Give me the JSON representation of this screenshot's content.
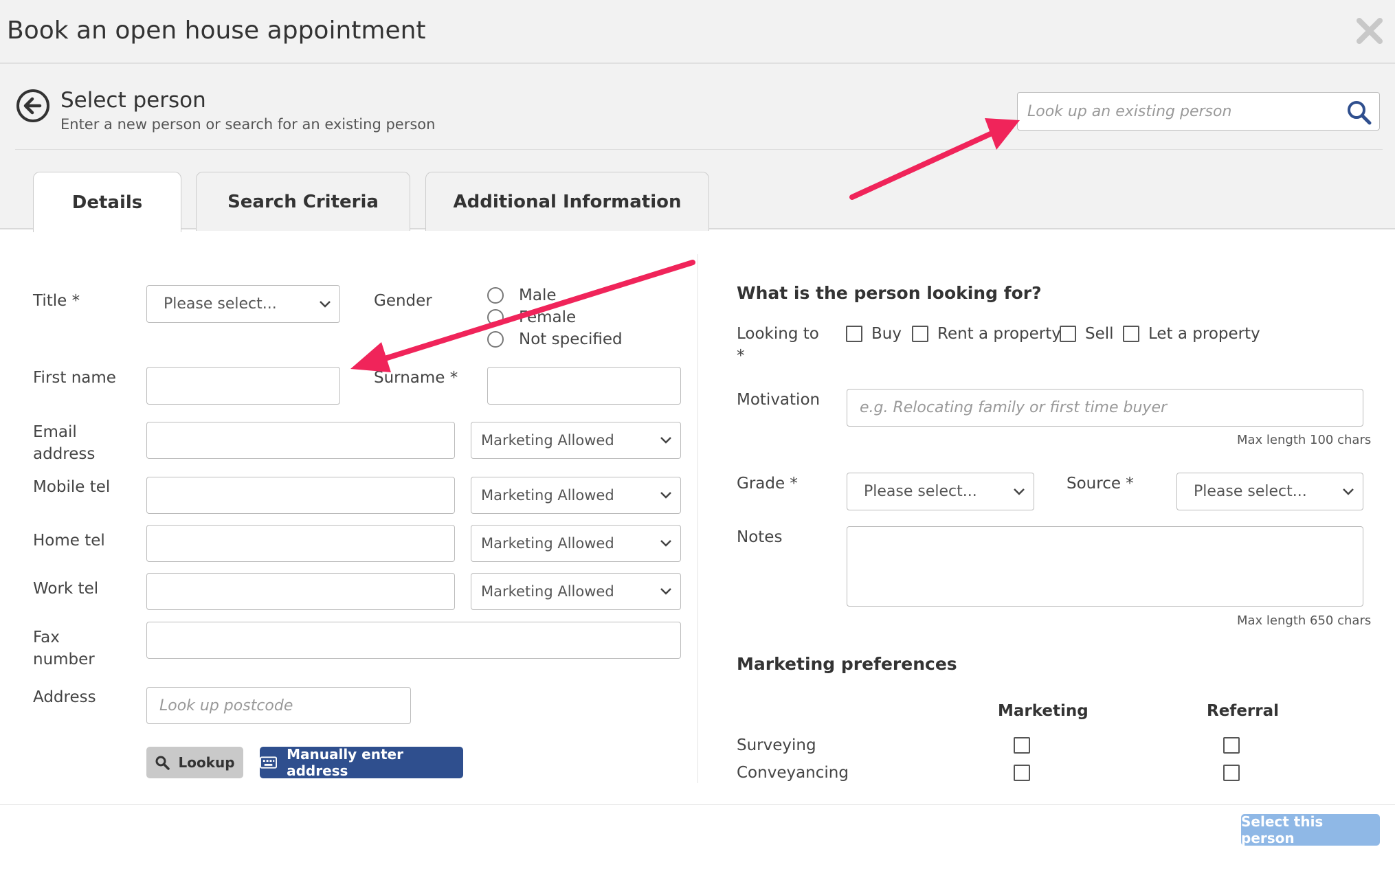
{
  "modal": {
    "title": "Book an open house appointment",
    "close_icon": "close-icon"
  },
  "person_bar": {
    "title": "Select person",
    "subtitle": "Enter a new person or search for an existing person",
    "lookup_placeholder": "Look up an existing person"
  },
  "tabs": [
    {
      "label": "Details",
      "active": true
    },
    {
      "label": "Search Criteria",
      "active": false
    },
    {
      "label": "Additional Information",
      "active": false
    }
  ],
  "details": {
    "title_label": "Title *",
    "title_select": "Please select...",
    "gender_label": "Gender",
    "gender_options": [
      "Male",
      "Female",
      "Not specified"
    ],
    "first_name_label": "First name",
    "surname_label": "Surname *",
    "email_label_1": "Email",
    "email_label_2": "address",
    "mobile_label": "Mobile tel",
    "home_label": "Home tel",
    "work_label": "Work tel",
    "fax_label_1": "Fax",
    "fax_label_2": "number",
    "address_label": "Address",
    "marketing_select": "Marketing Allowed",
    "postcode_placeholder": "Look up postcode",
    "lookup_button": "Lookup",
    "manual_button": "Manually enter address"
  },
  "looking": {
    "heading": "What is the person looking for?",
    "looking_to_label_1": "Looking to",
    "looking_to_label_2": "*",
    "options": [
      "Buy",
      "Rent a property",
      "Sell",
      "Let a property"
    ],
    "motivation_label": "Motivation",
    "motivation_placeholder": "e.g. Relocating family or first time buyer",
    "motivation_hint": "Max length 100 chars",
    "grade_label": "Grade *",
    "grade_select": "Please select...",
    "source_label": "Source *",
    "source_select": "Please select...",
    "notes_label": "Notes",
    "notes_hint": "Max length 650 chars"
  },
  "marketing_prefs": {
    "heading": "Marketing preferences",
    "columns": [
      "Marketing",
      "Referral"
    ],
    "rows": [
      "Surveying",
      "Conveyancing"
    ]
  },
  "footer": {
    "select_button": "Select this person"
  },
  "colors": {
    "accent_blue": "#2f4f8e",
    "disabled_blue": "#8fb8e6",
    "annotation_arrow": "#f0245a"
  }
}
